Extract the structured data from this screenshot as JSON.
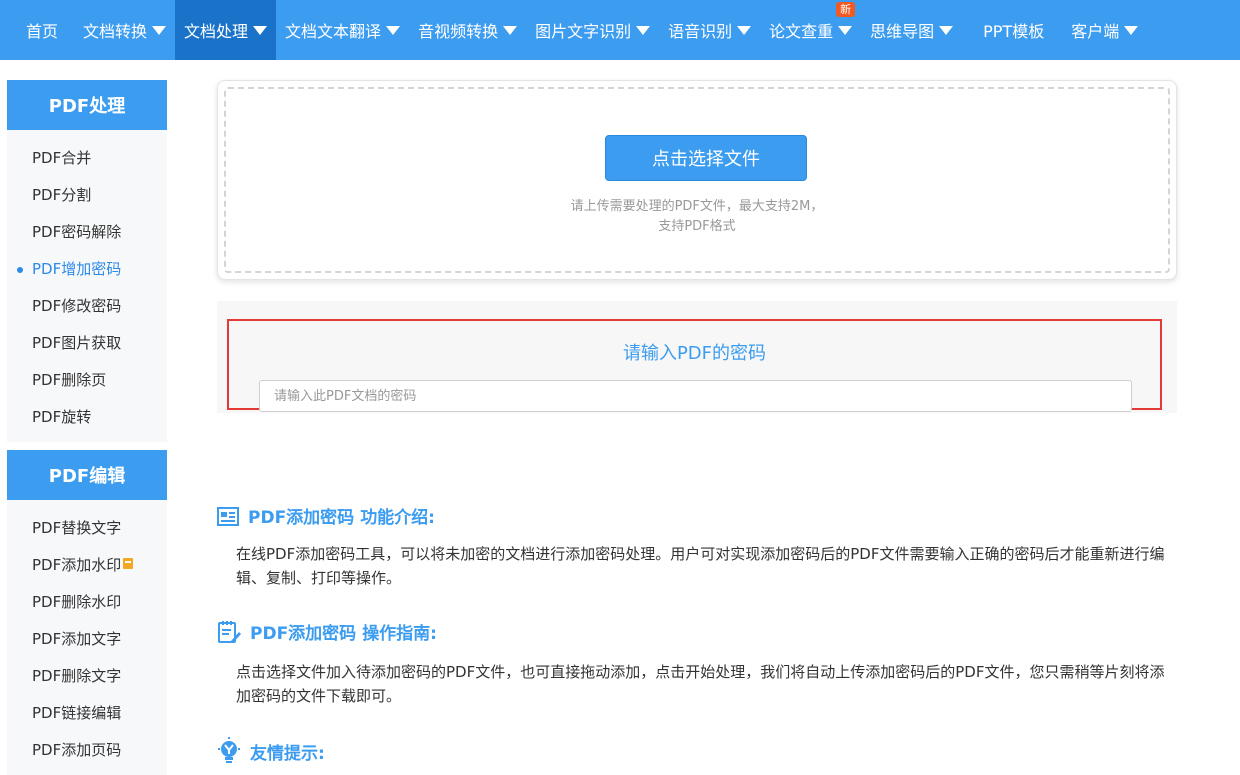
{
  "nav": {
    "items": [
      {
        "label": "首页",
        "caret": false,
        "active": false
      },
      {
        "label": "文档转换",
        "caret": true,
        "active": false
      },
      {
        "label": "文档处理",
        "caret": true,
        "active": true
      },
      {
        "label": "文档文本翻译",
        "caret": true,
        "active": false
      },
      {
        "label": "音视频转换",
        "caret": true,
        "active": false
      },
      {
        "label": "图片文字识别",
        "caret": true,
        "active": false
      },
      {
        "label": "语音识别",
        "caret": true,
        "active": false
      },
      {
        "label": "论文查重",
        "caret": true,
        "active": false,
        "badge": "新"
      },
      {
        "label": "思维导图",
        "caret": true,
        "active": false
      },
      {
        "label": "PPT模板",
        "caret": false,
        "active": false
      },
      {
        "label": "客户端",
        "caret": true,
        "active": false
      }
    ]
  },
  "sidebar": {
    "group1": {
      "title": "PDF处理",
      "items": [
        "PDF合并",
        "PDF分割",
        "PDF密码解除",
        "PDF增加密码",
        "PDF修改密码",
        "PDF图片获取",
        "PDF删除页",
        "PDF旋转"
      ],
      "active_index": 3
    },
    "group2": {
      "title": "PDF编辑",
      "items": [
        "PDF替换文字",
        "PDF添加水印",
        "PDF删除水印",
        "PDF添加文字",
        "PDF删除文字",
        "PDF链接编辑",
        "PDF添加页码"
      ]
    }
  },
  "upload": {
    "button_label": "点击选择文件",
    "hint_line1": "请上传需要处理的PDF文件，最大支持2M，",
    "hint_line2": "支持PDF格式"
  },
  "password": {
    "title": "请输入PDF的密码",
    "placeholder": "请输入此PDF文档的密码",
    "value": ""
  },
  "intro": {
    "title_a": "PDF添加密码",
    "title_b": "功能介绍:",
    "text": "在线PDF添加密码工具，可以将未加密的文档进行添加密码处理。用户可对实现添加密码后的PDF文件需要输入正确的密码后才能重新进行编辑、复制、打印等操作。"
  },
  "guide": {
    "title_a": "PDF添加密码",
    "title_b": "操作指南:",
    "text": "点击选择文件加入待添加密码的PDF文件，也可直接拖动添加，点击开始处理，我们将自动上传添加密码后的PDF文件，您只需稍等片刻将添加密码的文件下载即可。"
  },
  "tips": {
    "title": "友情提示:"
  },
  "colors": {
    "primary": "#3c9cf0",
    "nav_active": "#1a73c9",
    "highlight_border": "#e53935",
    "badge": "#f05a22"
  }
}
